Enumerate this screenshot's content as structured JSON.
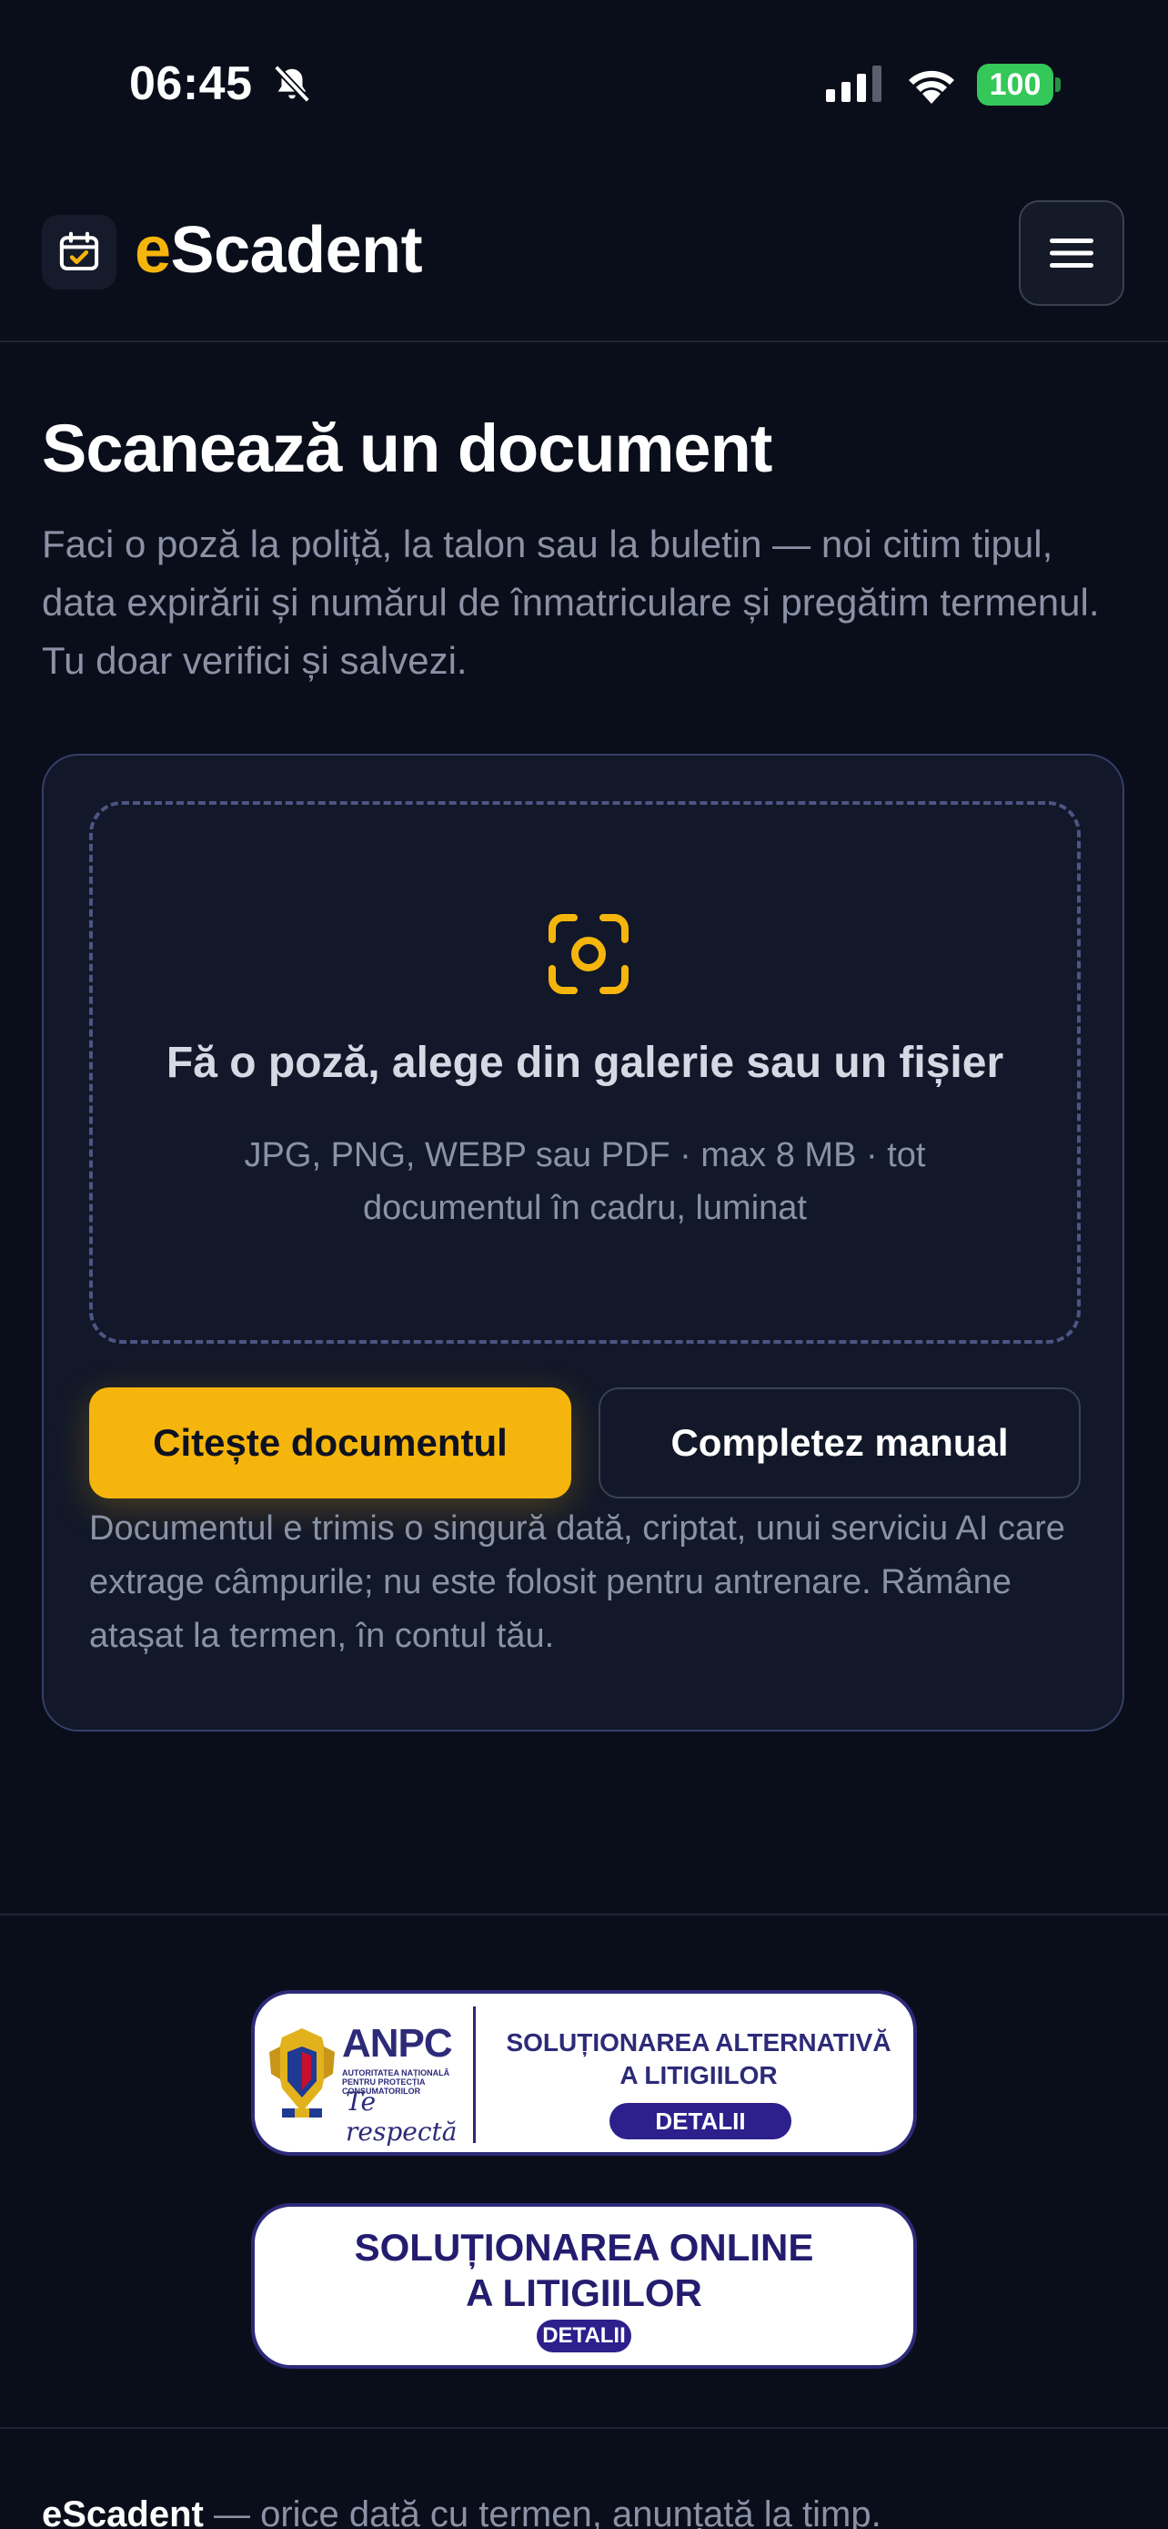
{
  "status_bar": {
    "time": "06:45",
    "battery": "100",
    "battery_color": "#34c759"
  },
  "header": {
    "logo_prefix": "e",
    "logo_rest": "Scadent",
    "logo_icon": "calendar-check-icon",
    "menu_icon": "hamburger-menu-icon",
    "accent_color": "#f5b50c"
  },
  "intro": {
    "title": "Scanează un document",
    "description": "Faci o poză la poliță, la talon sau la buletin — noi citim tipul, data expirării și numărul de înmatriculare și pregătim termenul. Tu doar verifici și salvezi."
  },
  "upload": {
    "icon": "camera-scan-icon",
    "title": "Fă o poză, alege din galerie sau un fișier",
    "hint": "JPG, PNG, WEBP sau PDF · max 8 MB · tot documentul în cadru, luminat",
    "read_button": "Citește documentul",
    "manual_button": "Completez manual",
    "privacy_note": "Documentul e trimis o singură dată, criptat, unui serviciu AI care extrage câmpurile; nu este folosit pentru antrenare. Rămâne atașat la termen, în contul tău."
  },
  "footer": {
    "anpc_badge": {
      "logo_text": "ANPC",
      "authority_text": "AUTORITATEA NAȚIONALĂ PENTRU PROTECȚIA CONSUMATORILOR",
      "motto": "Te respectă",
      "title_line1": "SOLUȚIONAREA ALTERNATIVĂ",
      "title_line2": "A LITIGIILOR",
      "detail_label": "DETALII"
    },
    "sol_badge": {
      "title_line1": "SOLUȚIONAREA ONLINE",
      "title_line2": "A LITIGIILOR",
      "detail_label": "DETALII"
    },
    "tagline_brand": "eScadent",
    "tagline_rest": " — orice dată cu termen, anunțată la timp."
  }
}
